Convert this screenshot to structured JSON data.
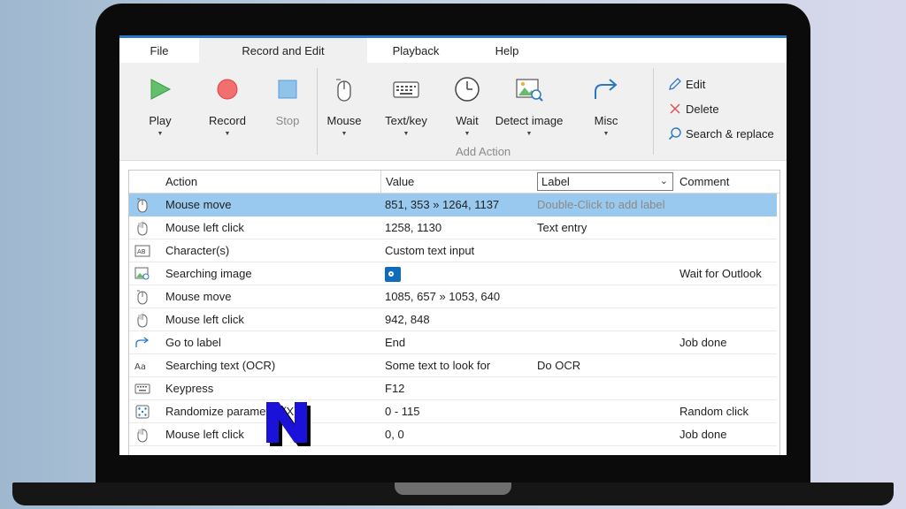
{
  "menu": {
    "tabs": [
      "File",
      "Record and Edit",
      "Playback",
      "Help"
    ],
    "active_index": 1
  },
  "ribbon": {
    "play": "Play",
    "record": "Record",
    "stop": "Stop",
    "mouse": "Mouse",
    "textkey": "Text/key",
    "wait": "Wait",
    "detect_image": "Detect image",
    "misc": "Misc",
    "group_label": "Add Action",
    "edit": "Edit",
    "delete": "Delete",
    "search_replace": "Search & replace"
  },
  "grid": {
    "columns": {
      "action": "Action",
      "value": "Value",
      "label": "Label",
      "comment": "Comment"
    },
    "rows": [
      {
        "icon": "mouse-icon",
        "action": "Mouse move",
        "value": "851, 353 » 1264, 1137",
        "label": "Double-Click to add label",
        "comment": ""
      },
      {
        "icon": "mouse-click-icon",
        "action": "Mouse left click",
        "value": "1258, 1130",
        "label": "Text entry",
        "comment": ""
      },
      {
        "icon": "text-input-icon",
        "action": "Character(s)",
        "value": "Custom text input",
        "label": "",
        "comment": ""
      },
      {
        "icon": "image-search-icon",
        "action": "Searching image",
        "value": "",
        "label": "",
        "comment": "Wait for Outlook"
      },
      {
        "icon": "mouse-icon",
        "action": "Mouse move",
        "value": "1085, 657 » 1053, 640",
        "label": "",
        "comment": ""
      },
      {
        "icon": "mouse-click-icon",
        "action": "Mouse left click",
        "value": "942, 848",
        "label": "",
        "comment": ""
      },
      {
        "icon": "goto-arrow-icon",
        "action": "Go to label",
        "value": "End",
        "label": "",
        "comment": "Job done"
      },
      {
        "icon": "ocr-icon",
        "action": "Searching text (OCR)",
        "value": "Some text to look for",
        "label": "Do OCR",
        "comment": ""
      },
      {
        "icon": "keyboard-icon",
        "action": "Keypress",
        "value": "F12",
        "label": "",
        "comment": ""
      },
      {
        "icon": "dice-icon",
        "action": "Randomize parameter (X)",
        "value": "0 - 115",
        "label": "",
        "comment": "Random click"
      },
      {
        "icon": "mouse-click-icon",
        "action": "Mouse left click",
        "value": "0, 0",
        "label": "",
        "comment": "Job done"
      }
    ]
  },
  "colors": {
    "selection": "#99c9ef",
    "accent": "#2b77c7",
    "play": "#4caf50",
    "record": "#f06464",
    "stop": "#7db8e8"
  }
}
